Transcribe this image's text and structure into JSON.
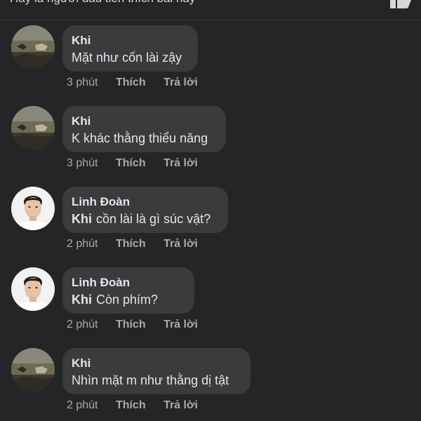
{
  "header": {
    "text": "Hãy là người đầu tiên thích bài này"
  },
  "colors": {
    "background": "#242526",
    "bubble": "#3a3b3c",
    "text": "#e4e6eb",
    "meta": "#a8abaf"
  },
  "comments": [
    {
      "avatar": "landscape-avatar",
      "author": "Khi",
      "mention": "",
      "text": "Mặt như cốn lài zậy",
      "time": "3 phút",
      "like_label": "Thích",
      "reply_label": "Trả lời"
    },
    {
      "avatar": "landscape-avatar",
      "author": "Khi",
      "mention": "",
      "text": "K khác thằng thiểu năng",
      "time": "3 phút",
      "like_label": "Thích",
      "reply_label": "Trả lời"
    },
    {
      "avatar": "person-avatar",
      "author": "Linh Đoàn",
      "mention": "Khi",
      "text": "cồn lài là gì súc vật?",
      "time": "2 phút",
      "like_label": "Thích",
      "reply_label": "Trả lời"
    },
    {
      "avatar": "person-avatar",
      "author": "Linh Đoàn",
      "mention": "Khi",
      "text": "Còn phím?",
      "time": "2 phút",
      "like_label": "Thích",
      "reply_label": "Trả lời"
    },
    {
      "avatar": "landscape-avatar",
      "author": "Khi",
      "mention": "",
      "text": "Nhìn mặt m như thằng dị tật",
      "time": "2 phút",
      "like_label": "Thích",
      "reply_label": "Trả lời"
    }
  ]
}
